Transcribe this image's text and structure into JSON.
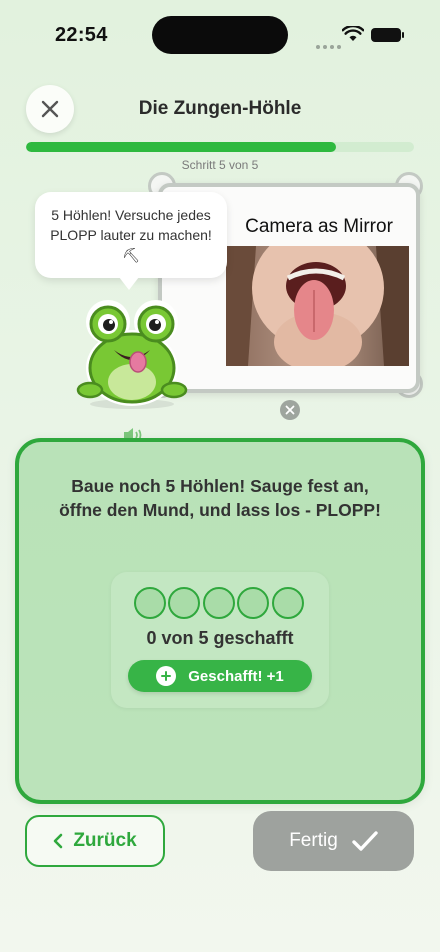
{
  "status_bar": {
    "time": "22:54"
  },
  "header": {
    "title": "Die Zungen-Höhle",
    "progress": {
      "current": 5,
      "total": 5,
      "fill_fraction": 0.8,
      "label": "Schritt 5 von 5"
    }
  },
  "mascot": {
    "speech": "5 Höhlen! Versuche jedes PLOPP lauter zu machen! ",
    "speech_icon": "⛏"
  },
  "camera": {
    "label": "Camera as Mirror"
  },
  "exercise": {
    "instruction": "Baue noch 5 Höhlen! Sauge fest an, öffne den Mund, und lass los - PLOPP!",
    "counter_text": "0 von 5 geschafft",
    "completed": 0,
    "target": 5,
    "done_button": "Geschafft! +1"
  },
  "footer": {
    "back_label": "Zurück",
    "finish_label": "Fertig"
  },
  "colors": {
    "accent": "#2fa83d",
    "progress": "#2eb93f",
    "disabled": "#9ea29e"
  }
}
